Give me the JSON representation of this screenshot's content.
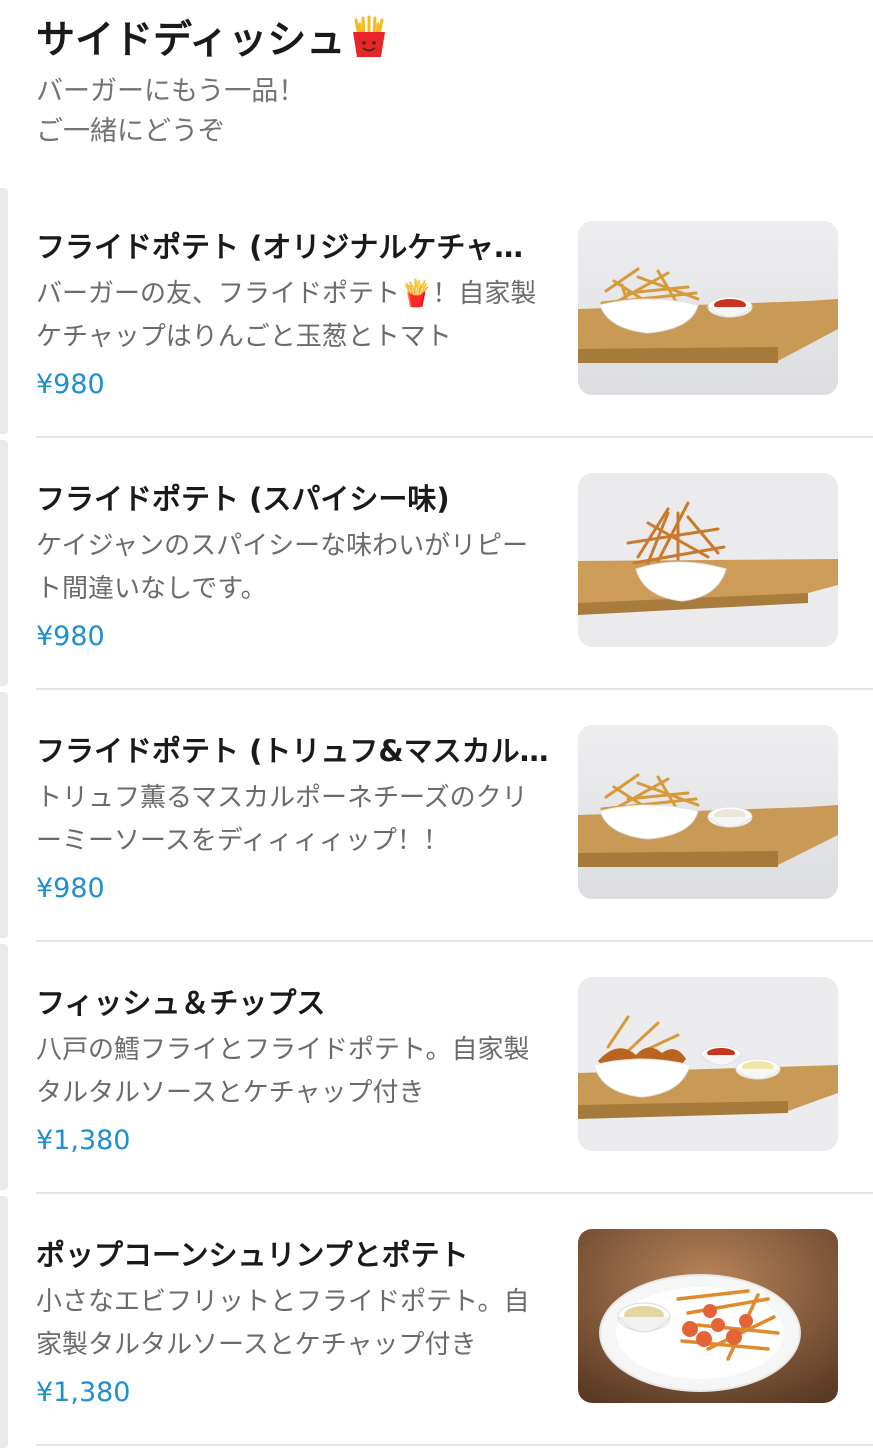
{
  "section": {
    "title": "サイドディッシュ",
    "title_icon": "french-fries-emoji",
    "subtitle_lines": [
      "バーガーにもう一品！",
      "ご一緒にどうぞ"
    ]
  },
  "items": [
    {
      "name": "フライドポテト (オリジナルケチャップ)",
      "description": "バーガーの友、フライドポテト🍟！自家製ケチャップはりんごと玉葱とトマト",
      "price": "¥980",
      "image": "fries-with-ketchup"
    },
    {
      "name": "フライドポテト (スパイシー味)",
      "description": "ケイジャンのスパイシーな味わいがリピート間違いなしです。",
      "price": "¥980",
      "image": "spicy-fries"
    },
    {
      "name": "フライドポテト (トリュフ&マスカルポーネ)",
      "description": "トリュフ薫るマスカルポーネチーズのクリーミーソースをディィィィップ！！",
      "price": "¥980",
      "image": "fries-with-truffle-sauce"
    },
    {
      "name": "フィッシュ＆チップス",
      "description": "八戸の鱈フライとフライドポテト。自家製タルタルソースとケチャップ付き",
      "price": "¥1,380",
      "image": "fish-and-chips"
    },
    {
      "name": "ポップコーンシュリンプとポテト",
      "description": "小さなエビフリットとフライドポテト。自家製タルタルソースとケチャップ付き",
      "price": "¥1,380",
      "image": "popcorn-shrimp-and-fries"
    }
  ],
  "colors": {
    "price": "#1e8fcf",
    "description": "#6b6b6b",
    "subtitle": "#737373",
    "divider": "#e6e6e6"
  }
}
